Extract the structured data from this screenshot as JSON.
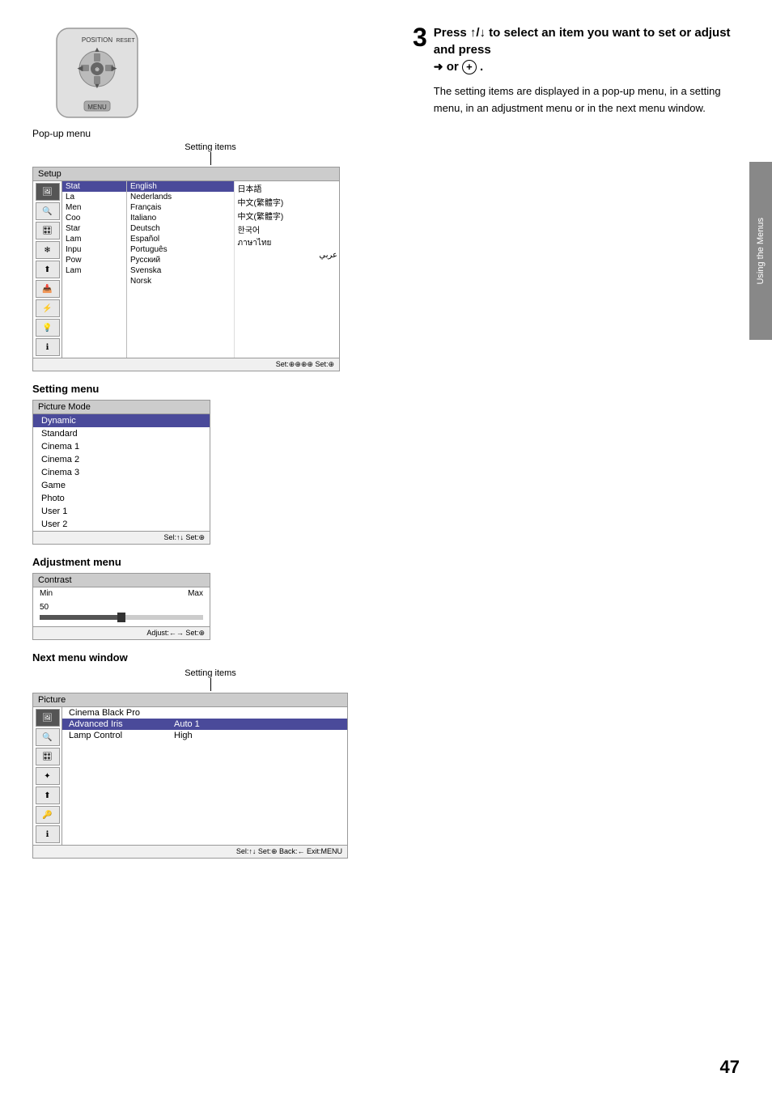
{
  "sidebar": {
    "label": "Using the Menus"
  },
  "step3": {
    "number": "3",
    "heading": "Press ↑/↓ to select an item you want to set or adjust and press",
    "arrow": "➜",
    "or": "or",
    "circle_btn": "⊕",
    "description": "The setting items are displayed in a pop-up menu, in a setting menu, in an adjustment menu or in the next menu window."
  },
  "popup_menu": {
    "label": "Pop-up menu",
    "setting_items_label": "Setting items",
    "header": "Setup",
    "left_panel_items": [
      {
        "icon": "🖼",
        "label": "Stat"
      },
      {
        "icon": "🔍",
        "label": "La"
      },
      {
        "icon": "🎛",
        "label": "Men"
      },
      {
        "icon": "❄",
        "label": "Coo"
      },
      {
        "icon": "✦",
        "label": "Star"
      },
      {
        "icon": "⬆",
        "label": "Lam"
      },
      {
        "icon": "📥",
        "label": "Inpu"
      },
      {
        "icon": "⚡",
        "label": "Pow"
      },
      {
        "icon": "💡",
        "label": "Lam"
      }
    ],
    "lang_col1": [
      "English",
      "Nederlands",
      "Français",
      "Italiano",
      "Deutsch",
      "Español",
      "Português",
      "Русский",
      "Svenska",
      "Norsk"
    ],
    "lang_col2": [
      "日本語",
      "中文(繁體字)",
      "中文(繁體字)",
      "한국어",
      "ภาษาไทย",
      "عربي",
      "",
      "",
      "",
      ""
    ],
    "status": "Set:⊕⊕⊕⊕  Set:⊕"
  },
  "setting_menu": {
    "label": "Setting menu",
    "header": "Picture Mode",
    "items": [
      "Dynamic",
      "Standard",
      "Cinema 1",
      "Cinema 2",
      "Cinema 3",
      "Game",
      "Photo",
      "User 1",
      "User 2"
    ],
    "active_item": "Dynamic",
    "status": "Sel:↑↓  Set:⊕"
  },
  "adjustment_menu": {
    "label": "Adjustment menu",
    "header": "Contrast",
    "min_label": "Min",
    "max_label": "Max",
    "value": "50",
    "slider_percent": 50,
    "status": "Adjust:←→  Set:⊕"
  },
  "next_menu": {
    "label": "Next menu window",
    "setting_items_label": "Setting items",
    "header": "Picture",
    "icons": [
      "🖼",
      "🔍",
      "🎛",
      "✦",
      "⬆",
      "🔑",
      "ℹ"
    ],
    "active_icon_index": 0,
    "rows": [
      {
        "col1": "Cinema Black Pro",
        "col2": "",
        "highlighted": false
      },
      {
        "col1": "Advanced Iris",
        "col2": "Auto 1",
        "highlighted": true
      },
      {
        "col1": "Lamp Control",
        "col2": "High",
        "highlighted": false
      }
    ],
    "status": "Sel:↑↓  Set:⊕  Back:←  Exit:MENU"
  },
  "page_number": "47"
}
